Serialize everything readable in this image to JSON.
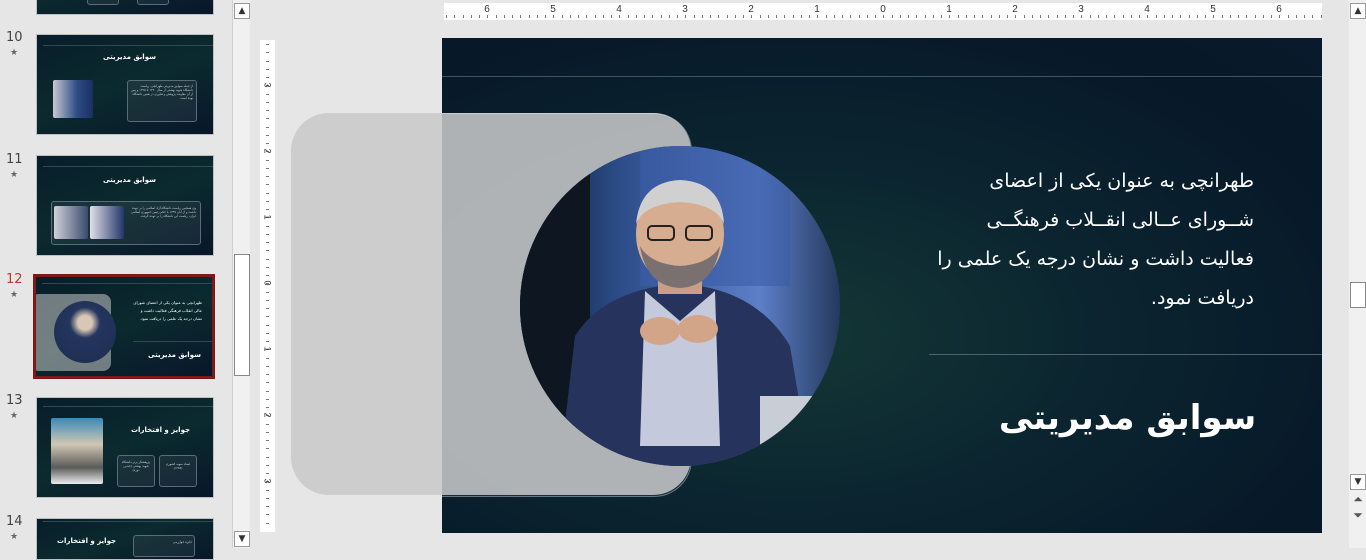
{
  "thumbnails": [
    {
      "number": "10",
      "title": "سوابق مدیریتی",
      "text": "از جمله سوابق مدیریتی طهرانچی، ریاست دانشگاه شهید بهشتی از سال ۱۳۹۰ تا ۱۳۹۵ و پس از آن معاونت پژوهش و فناوری در همین دانشگاه بوده است."
    },
    {
      "number": "11",
      "title": "سوابق مدیریتی",
      "text": "وی همچنین ریاست دانشگاه آزاد اسلامی را بر عهده داشت و از آبان ۱۳۹۷ با حکم رئیس جمهوری اسلامی ایران، ریاست این دانشگاه را بر عهده گرفت."
    },
    {
      "number": "12",
      "title": "سوابق مدیریتی",
      "text": "طهرانچی به عنوان یکی از اعضای شورای عالی انقلاب فرهنگی فعالیت داشت و نشان درجه یک علمی را دریافت نمود.",
      "active": true
    },
    {
      "number": "13",
      "title": "جوایز و افتخارات",
      "box1": "پژوهشگر برتر دانشگاه شهید بهشتی (چندین دوره)",
      "box2": "استاد نمونه کشوری (۱۳۸۷)"
    },
    {
      "number": "14",
      "title": "جوایز و افتخارات",
      "text": "جایزه خوارزمی"
    }
  ],
  "ruler": {
    "horizontal_labels": [
      "6",
      "5",
      "4",
      "3",
      "2",
      "1",
      "0",
      "1",
      "2",
      "3",
      "4",
      "5",
      "6"
    ],
    "vertical_labels": [
      "3",
      "2",
      "1",
      "0",
      "1",
      "2",
      "3"
    ]
  },
  "slide": {
    "body_text": "طهرانچی به عنوان یکی از اعضای شــورای عــالی انقــلاب فرهنگــی فعالیت داشت و نشان درجه یک علمی را دریافت نمود.",
    "title": "سوابق مدیریتی"
  },
  "colors": {
    "slide_bg": "#0b2530",
    "active_border": "#7a1a1a",
    "active_number": "#c0392b"
  },
  "icons": {
    "scroll_up": "▲",
    "scroll_down": "▼",
    "prev_slide": "⏶",
    "next_slide": "⏷",
    "star": "★"
  }
}
